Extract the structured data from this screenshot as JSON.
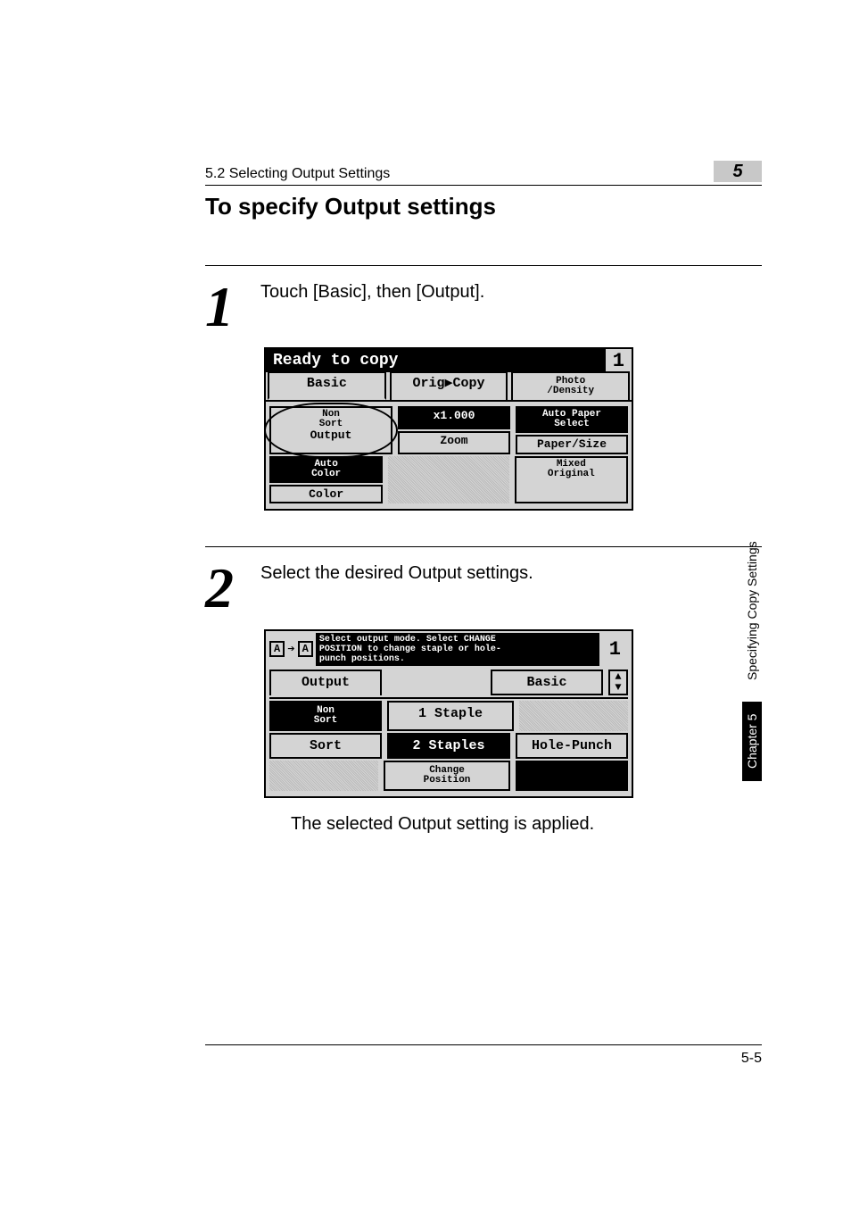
{
  "header": {
    "section": "5.2 Selecting Output Settings",
    "chapter_num": "5",
    "title": "To specify Output settings"
  },
  "steps": {
    "s1": {
      "num": "1",
      "text": "Touch [Basic], then [Output]."
    },
    "s2": {
      "num": "2",
      "text": "Select the desired Output settings."
    },
    "result": "The selected Output setting is applied."
  },
  "lcd1": {
    "status": "Ready to copy",
    "count": "1",
    "tab_basic": "Basic",
    "tab_orig": "Orig▶Copy",
    "tab_photo": "Photo\n/Density",
    "nonsort": "Non\nSort",
    "output": "Output",
    "x1000": "x1.000",
    "zoom": "Zoom",
    "autopaper": "Auto Paper\nSelect",
    "papersize": "Paper/Size",
    "autocolor": "Auto\nColor",
    "color": "Color",
    "mixed": "Mixed\nOriginal"
  },
  "lcd2": {
    "hint": "Select output mode. Select CHANGE\nPOSITION to change staple or hole-\npunch positions.",
    "count": "1",
    "output_tab": "Output",
    "basic_btn": "Basic",
    "nonsort": "Non\nSort",
    "staple1": "1 Staple",
    "sort": "Sort",
    "staples2": "2 Staples",
    "holepunch": "Hole-Punch",
    "changepos": "Change\nPosition"
  },
  "side": {
    "chapter": "Chapter 5",
    "title": "Specifying Copy Settings"
  },
  "page_number": "5-5"
}
